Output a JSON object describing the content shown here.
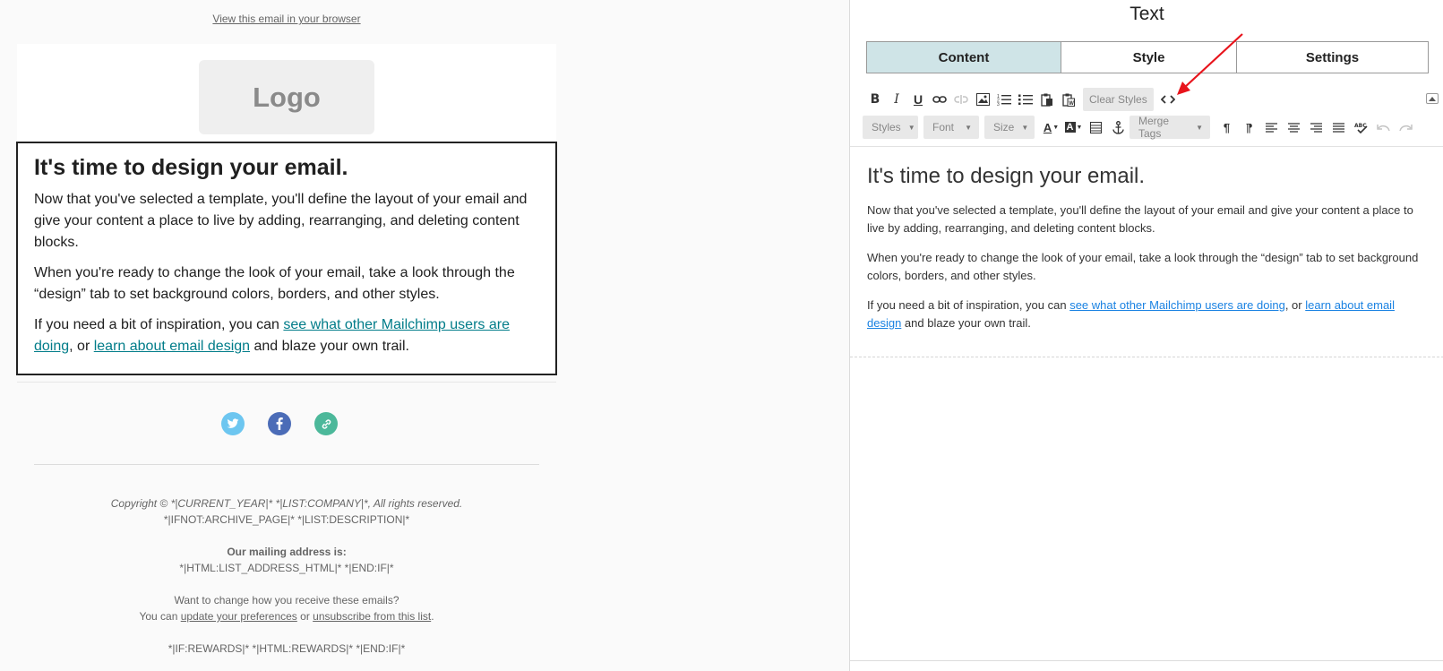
{
  "preview": {
    "view_in_browser": "View this email in your browser",
    "logo_text": "Logo",
    "heading": "It's time to design your email.",
    "para1": "Now that you've selected a template, you'll define the layout of your email and give your content a place to live by adding, rearranging, and deleting content blocks.",
    "para2": "When you're ready to change the look of your email, take a look through the “design” tab to set background colors, borders, and other styles.",
    "para3_pre": "If you need a bit of inspiration, you can ",
    "link1": "see what other Mailchimp users are doing",
    "para3_mid": ", or ",
    "link2": "learn about email design",
    "para3_post": " and blaze your own trail.",
    "social": [
      {
        "name": "twitter-icon",
        "color": "#6dc6f0"
      },
      {
        "name": "facebook-icon",
        "color": "#4b6cb7"
      },
      {
        "name": "link-icon",
        "color": "#4cb89a"
      }
    ],
    "footer": {
      "copyright": "Copyright © *|CURRENT_YEAR|* *|LIST:COMPANY|*, All rights reserved.",
      "description": "*|IFNOT:ARCHIVE_PAGE|* *|LIST:DESCRIPTION|*",
      "mailing_label": "Our mailing address is:",
      "address": "*|HTML:LIST_ADDRESS_HTML|* *|END:IF|*",
      "change_question": "Want to change how you receive these emails?",
      "you_can": "You can ",
      "update_link": "update your preferences",
      "or": " or ",
      "unsubscribe_link": "unsubscribe from this list",
      "period": ".",
      "rewards": "*|IF:REWARDS|* *|HTML:REWARDS|* *|END:IF|*"
    }
  },
  "editor": {
    "title": "Text",
    "tabs": [
      "Content",
      "Style",
      "Settings"
    ],
    "toolbar1": {
      "clear_styles": "Clear Styles"
    },
    "toolbar2": {
      "styles": "Styles",
      "font": "Font",
      "size": "Size",
      "merge_tags": "Merge Tags"
    },
    "content": {
      "heading": "It's time to design your email.",
      "para1": "Now that you've selected a template, you'll define the layout of your email and give your content a place to live by adding, rearranging, and deleting content blocks.",
      "para2": "When you're ready to change the look of your email, take a look through the “design” tab to set background colors, borders, and other styles.",
      "para3_pre": "If you need a bit of inspiration, you can ",
      "link1": "see what other Mailchimp users are doing",
      "para3_mid": ", or ",
      "link2": "learn about email design",
      "para3_post": " and blaze your own trail."
    }
  },
  "colors": {
    "active_tab": "#cfe4e7",
    "preview_link": "#007c89",
    "editor_link": "#1a82e2",
    "annotation_arrow": "#e8141c"
  }
}
